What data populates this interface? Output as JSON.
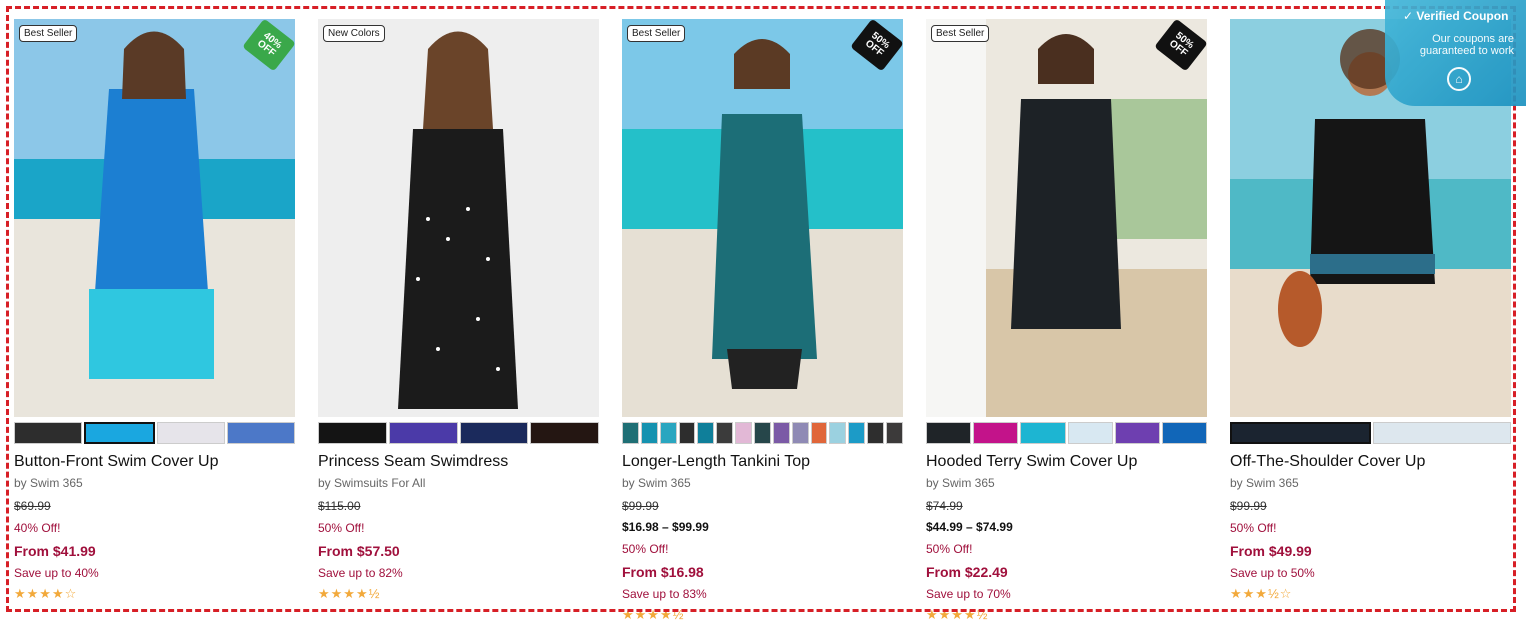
{
  "coupon": {
    "title": "Verified Coupon",
    "message": "Our coupons are guaranteed to work",
    "check_icon": "check-circle-icon",
    "home_icon": "home-icon"
  },
  "products": [
    {
      "badge": "Best Seller",
      "off_tag": "40% OFF",
      "name": "Button-Front Swim Cover Up",
      "brand": "by Swim 365",
      "was": "$69.99",
      "range": "",
      "pct": "40% Off!",
      "from": "From $41.99",
      "save": "Save up to 40%",
      "stars": "★★★★☆",
      "swatches": [
        "#2d2d2d",
        "#1aa7e0",
        "#e6e4ea",
        "#4c78c8"
      ]
    },
    {
      "badge": "New Colors",
      "off_tag": "",
      "name": "Princess Seam Swimdress",
      "brand": "by Swimsuits For All",
      "was": "$115.00",
      "range": "",
      "pct": "50% Off!",
      "from": "From $57.50",
      "save": "Save up to 82%",
      "stars": "★★★★½",
      "swatches": [
        "#141414",
        "#4b3aa8",
        "#1b2a5c",
        "#241612"
      ]
    },
    {
      "badge": "Best Seller",
      "off_tag": "50% OFF",
      "name": "Longer-Length Tankini Top",
      "brand": "by Swim 365",
      "was": "$99.99",
      "range": "$16.98 – $99.99",
      "pct": "50% Off!",
      "from": "From $16.98",
      "save": "Save up to 83%",
      "stars": "★★★★½",
      "swatches": [
        "#1f6f75",
        "#1592b0",
        "#2aa6c0",
        "#2d2d2d",
        "#0f7f9a",
        "#3b3b3b",
        "#e2b8d6",
        "#26464a",
        "#7b5aa6",
        "#8f8ab5",
        "#e0663a",
        "#9bd1e0",
        "#1c9bc7",
        "#2e2e2e",
        "#3c3a3a"
      ]
    },
    {
      "badge": "Best Seller",
      "off_tag": "50% OFF",
      "name": "Hooded Terry Swim Cover Up",
      "brand": "by Swim 365",
      "was": "$74.99",
      "range": "$44.99 – $74.99",
      "pct": "50% Off!",
      "from": "From $22.49",
      "save": "Save up to 70%",
      "stars": "★★★★½",
      "swatches": [
        "#1f2428",
        "#c3138a",
        "#1db5d2",
        "#d8e8f2",
        "#6e3fb0",
        "#1166b8"
      ]
    },
    {
      "badge": "",
      "off_tag": "",
      "name": "Off-The-Shoulder Cover Up",
      "brand": "by Swim 365",
      "was": "$99.99",
      "range": "",
      "pct": "50% Off!",
      "from": "From $49.99",
      "save": "Save up to 50%",
      "stars": "★★★½☆",
      "swatches": [
        "#1b2430",
        "#dde7ee"
      ]
    }
  ]
}
